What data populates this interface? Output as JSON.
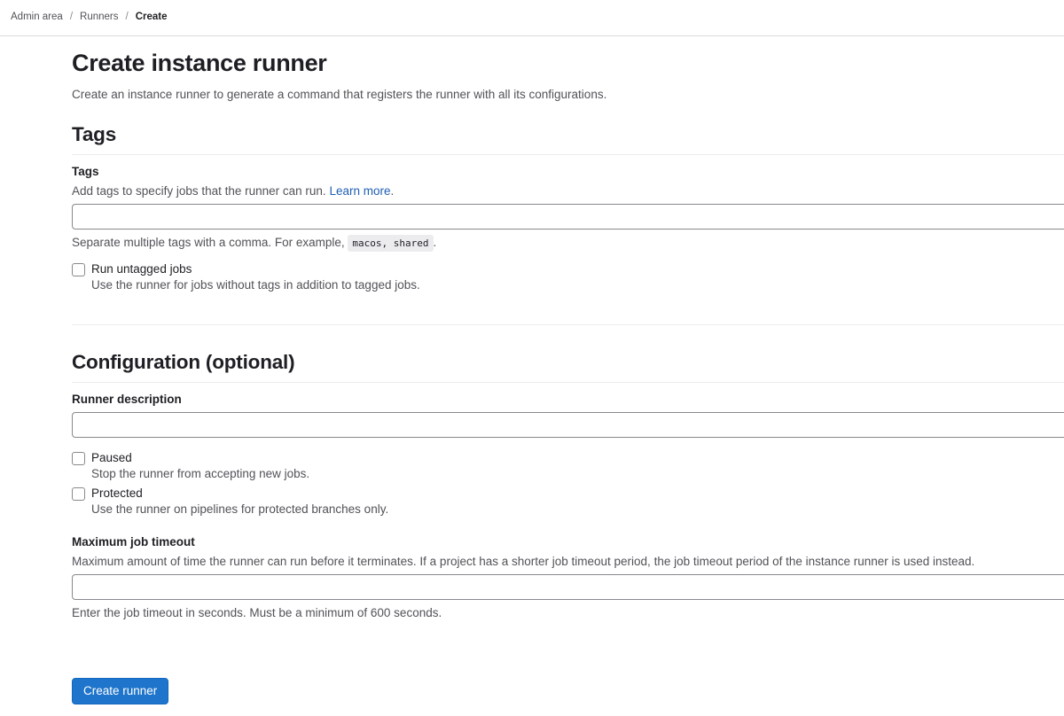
{
  "breadcrumb": {
    "items": [
      "Admin area",
      "Runners"
    ],
    "separator": "/",
    "current": "Create"
  },
  "page": {
    "title": "Create instance runner",
    "description": "Create an instance runner to generate a command that registers the runner with all its configurations."
  },
  "tags_section": {
    "heading": "Tags",
    "tags_field": {
      "label": "Tags",
      "help_prefix": "Add tags to specify jobs that the runner can run.",
      "help_link": "Learn more",
      "help_suffix": ".",
      "value": "",
      "hint_prefix": "Separate multiple tags with a comma. For example,",
      "hint_code": "macos, shared",
      "hint_suffix": "."
    },
    "run_untagged": {
      "label": "Run untagged jobs",
      "help": "Use the runner for jobs without tags in addition to tagged jobs.",
      "checked": false
    }
  },
  "config_section": {
    "heading": "Configuration (optional)",
    "description_field": {
      "label": "Runner description",
      "value": ""
    },
    "paused": {
      "label": "Paused",
      "help": "Stop the runner from accepting new jobs.",
      "checked": false
    },
    "protected": {
      "label": "Protected",
      "help": "Use the runner on pipelines for protected branches only.",
      "checked": false
    },
    "timeout_field": {
      "label": "Maximum job timeout",
      "help": "Maximum amount of time the runner can run before it terminates. If a project has a shorter job timeout period, the job timeout period of the instance runner is used instead.",
      "value": "",
      "hint": "Enter the job timeout in seconds. Must be a minimum of 600 seconds."
    }
  },
  "actions": {
    "submit_label": "Create runner"
  },
  "colors": {
    "primary": "#1f75cb",
    "link": "#1f5fb2",
    "text": "#333238",
    "muted": "#535158",
    "border": "#89888d"
  }
}
